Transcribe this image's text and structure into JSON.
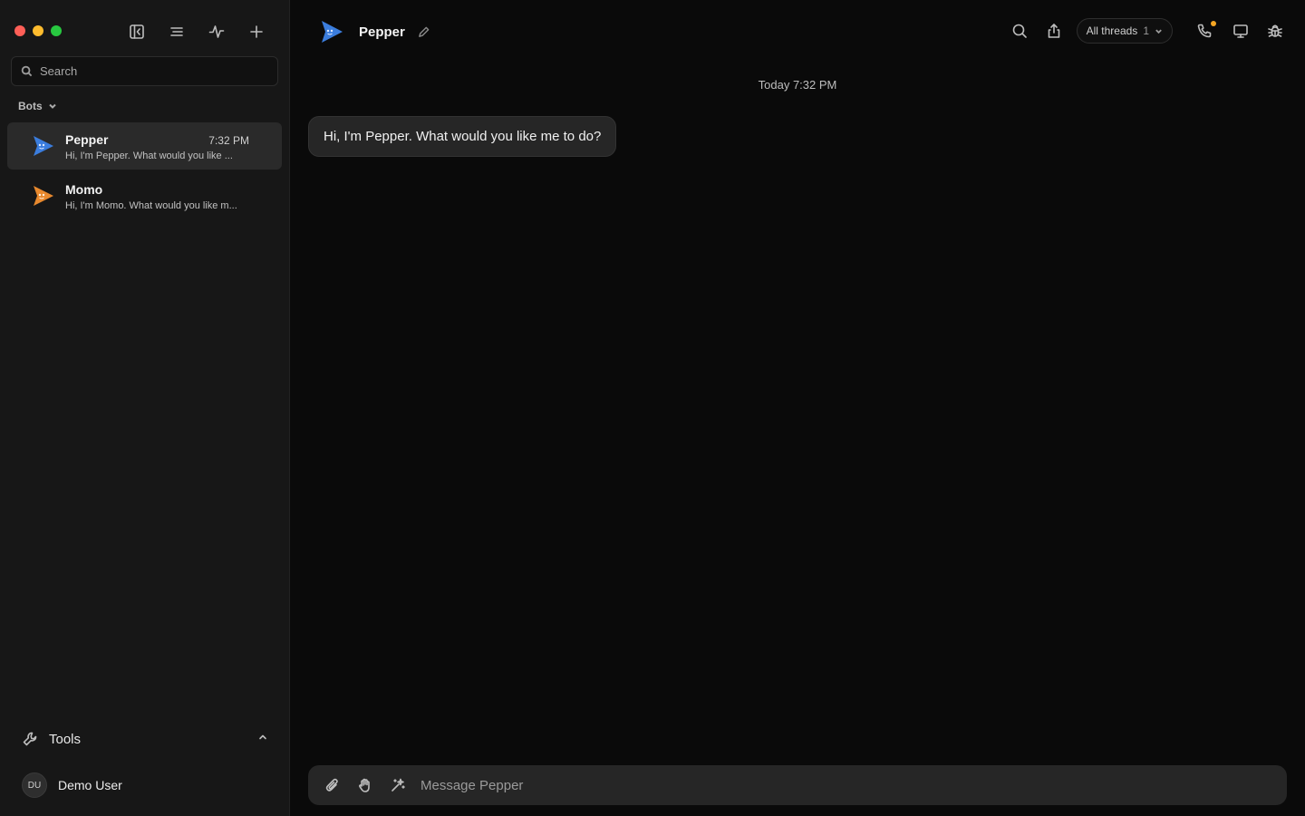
{
  "window": {
    "controls": [
      "close",
      "minimize",
      "maximize"
    ]
  },
  "sidebar": {
    "toolbar_icons": [
      "sidebar-toggle-icon",
      "list-icon",
      "activity-icon",
      "plus-icon"
    ],
    "search": {
      "placeholder": "Search",
      "value": ""
    },
    "bots_section": {
      "label": "Bots"
    },
    "bots": [
      {
        "name": "Pepper",
        "time": "7:32 PM",
        "preview": "Hi, I'm Pepper. What would you like ...",
        "color": "#3b7ddd",
        "active": true
      },
      {
        "name": "Momo",
        "time": "",
        "preview": "Hi, I'm Momo. What would you like m...",
        "color": "#e8892e",
        "active": false
      }
    ],
    "tools": {
      "label": "Tools"
    },
    "user": {
      "initials": "DU",
      "name": "Demo User"
    }
  },
  "chat": {
    "title": "Pepper",
    "header_actions": {
      "threads_label": "All threads",
      "threads_count": "1",
      "phone_badge_color": "#f5a623"
    },
    "timestamp": "Today 7:32 PM",
    "messages": [
      {
        "from": "bot",
        "text": "Hi, I'm Pepper. What would you like me to do?"
      }
    ],
    "composer": {
      "placeholder": "Message Pepper",
      "value": ""
    }
  },
  "colors": {
    "background": "#0a0a0a",
    "sidebar": "#171717",
    "bubble": "#262626",
    "pepper": "#3b7ddd",
    "momo": "#e8892e"
  }
}
